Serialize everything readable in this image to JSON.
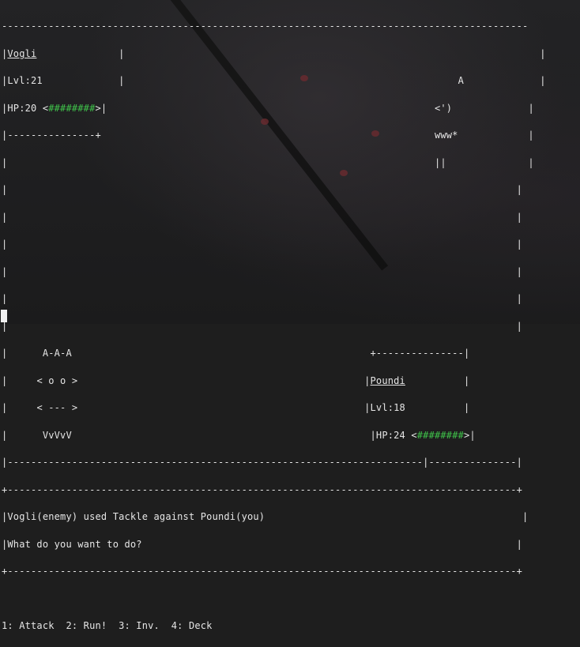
{
  "screen": {
    "border_top": "------------------------------------------------------------------------------------------",
    "enemy": {
      "name": "Vogli",
      "level_label": "Lvl:21",
      "hp_label": "HP:20",
      "hp_bar": "########"
    },
    "player": {
      "name": "Poundi",
      "level_label": "Lvl:18",
      "hp_label": "HP:24",
      "hp_bar": "########"
    },
    "enemy_sprite": [
      "A",
      "<')",
      "www*",
      "||"
    ],
    "player_sprite": [
      "A-A-A",
      "< o o >",
      "< --- >",
      "VvVvV"
    ],
    "messages": [
      "Vogli(enemy) used Tackle against Poundi(you)",
      "What do you want to do?"
    ],
    "menu": "1: Attack  2: Run!  3: Inv.  4: Deck"
  }
}
